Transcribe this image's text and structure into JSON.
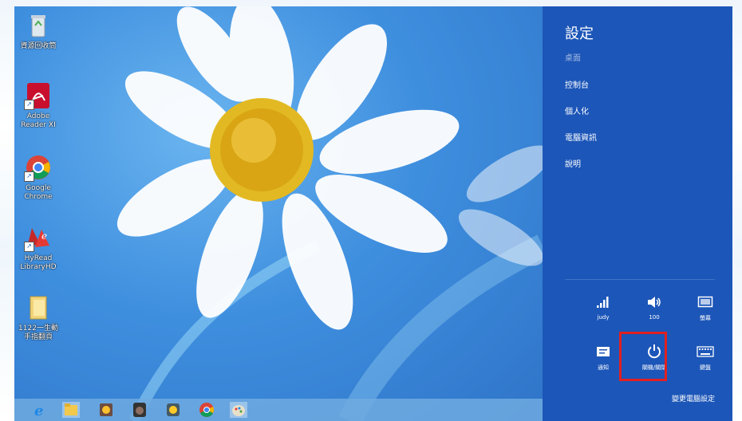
{
  "desktop_icons": [
    {
      "name": "recycle-bin-icon",
      "label": "資源回收筒"
    },
    {
      "name": "adobe-reader-icon",
      "label": "Adobe Reader XI"
    },
    {
      "name": "google-chrome-icon",
      "label": "Google Chrome"
    },
    {
      "name": "hyread-icon",
      "label": "HyRead LibraryHD"
    },
    {
      "name": "folder-icon",
      "label": "1122一生動 手指翻頁"
    }
  ],
  "charm": {
    "title": "設定",
    "subtitle": "桌面",
    "links": [
      "控制台",
      "個人化",
      "電腦資訊",
      "說明"
    ],
    "tiles": {
      "network": "judy",
      "volume": "100",
      "screen": "螢幕",
      "notifications": "通知",
      "power": "關機/關閉",
      "keyboard": "鍵盤"
    },
    "change_pc_settings": "變更電腦設定"
  },
  "colors": {
    "charm_bg": "#1c56b8",
    "highlight": "#e02020"
  }
}
